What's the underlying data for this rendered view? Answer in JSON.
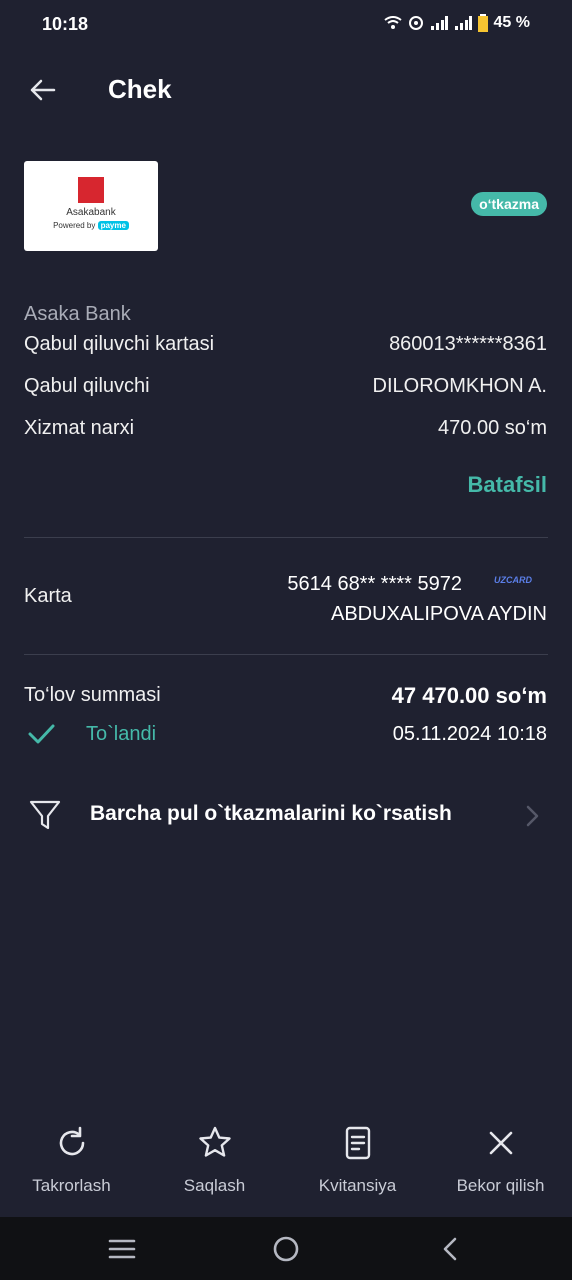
{
  "status_bar": {
    "time": "10:18",
    "battery": "45 %"
  },
  "header": {
    "title": "Chek"
  },
  "merchant": {
    "logo_name": "Asakabank",
    "powered_by": "Powered by",
    "payme": "payme",
    "badge": "o‘tkazma",
    "bank_name": "Asaka Bank"
  },
  "details": [
    {
      "label": "Qabul qiluvchi kartasi",
      "value": "860013******8361"
    },
    {
      "label": "Qabul qiluvchi",
      "value": "DILOROMKHON A."
    },
    {
      "label": "Xizmat narxi",
      "value": "470.00 so‘m"
    }
  ],
  "more_link": "Batafsil",
  "card": {
    "label": "Karta",
    "number": "5614 68** **** 5972",
    "brand": "UZCARD",
    "owner": "ABDUXALIPOVA AYDIN"
  },
  "payment": {
    "label": "To‘lov summasi",
    "amount": "47 470.00 so‘m",
    "status": "To`landi",
    "datetime": "05.11.2024 10:18"
  },
  "filter": {
    "label": "Barcha pul o`tkazmalarini ko`rsatish"
  },
  "actions": [
    {
      "label": "Takrorlash",
      "icon": "refresh-icon"
    },
    {
      "label": "Saqlash",
      "icon": "star-icon"
    },
    {
      "label": "Kvitansiya",
      "icon": "receipt-icon"
    },
    {
      "label": "Bekor qilish",
      "icon": "close-icon"
    }
  ],
  "colors": {
    "background": "#1f2130",
    "accent": "#45b9a9"
  }
}
